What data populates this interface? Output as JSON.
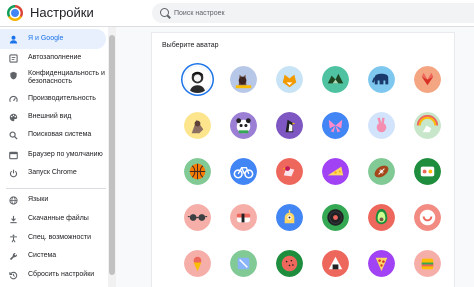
{
  "header": {
    "title": "Настройки",
    "search_placeholder": "Поиск настроек"
  },
  "sidebar": {
    "items": [
      {
        "label": "Я и Google",
        "icon": "person-icon"
      },
      {
        "label": "Автозаполнение",
        "icon": "autofill-icon"
      },
      {
        "label": "Конфиденциальность и безопасность",
        "icon": "shield-icon"
      },
      {
        "label": "Производительность",
        "icon": "speed-icon"
      },
      {
        "label": "Внешний вид",
        "icon": "palette-icon"
      },
      {
        "label": "Поисковая система",
        "icon": "search-icon"
      },
      {
        "label": "Браузер по умолчанию",
        "icon": "browser-icon"
      },
      {
        "label": "Запуск Chrome",
        "icon": "power-icon"
      },
      {
        "label": "Языки",
        "icon": "globe-icon"
      },
      {
        "label": "Скачанные файлы",
        "icon": "download-icon"
      },
      {
        "label": "Спец. возможности",
        "icon": "accessibility-icon"
      },
      {
        "label": "Система",
        "icon": "wrench-icon"
      },
      {
        "label": "Сбросить настройки",
        "icon": "history-icon"
      }
    ]
  },
  "main": {
    "section_title": "Выберите аватар",
    "avatars": [
      "avatar-portrait",
      "avatar-cat",
      "avatar-fox",
      "avatar-dragon",
      "avatar-elephant",
      "avatar-origami-fox",
      "avatar-monkey",
      "avatar-panda",
      "avatar-penguin",
      "avatar-butterfly",
      "avatar-rabbit",
      "avatar-unicorn",
      "avatar-basketball",
      "avatar-bicycle",
      "avatar-bird",
      "avatar-cheese",
      "avatar-football",
      "avatar-sushi-plate",
      "avatar-sunglasses",
      "avatar-sushi",
      "avatar-yellow-robot",
      "avatar-vinyl",
      "avatar-avocado",
      "avatar-smiley",
      "avatar-ice-cream",
      "avatar-ice-cube",
      "avatar-watermelon",
      "avatar-onigiri",
      "avatar-pizza",
      "avatar-sandwich"
    ],
    "colors": {
      "accent": "#1a73e8",
      "avatar_backgrounds": [
        "#ffffff",
        "#b7c7e8",
        "#c7e3f5",
        "#4fc3a1",
        "#7ec8f0",
        "#f4a582",
        "#fce58d",
        "#9b7fd4",
        "#7e57c2",
        "#4285f4",
        "#d2e3fc",
        "#c8e6c9",
        "#81c995",
        "#4285f4",
        "#ee675c",
        "#a142f4",
        "#81c995",
        "#1e8e3e",
        "#f6aea9",
        "#f6aea9",
        "#4285f4",
        "#34a853",
        "#ee675c",
        "#f28b82",
        "#f6aea9",
        "#81c995",
        "#1e8e3e",
        "#ee675c",
        "#a142f4",
        "#f6aea9"
      ]
    }
  }
}
